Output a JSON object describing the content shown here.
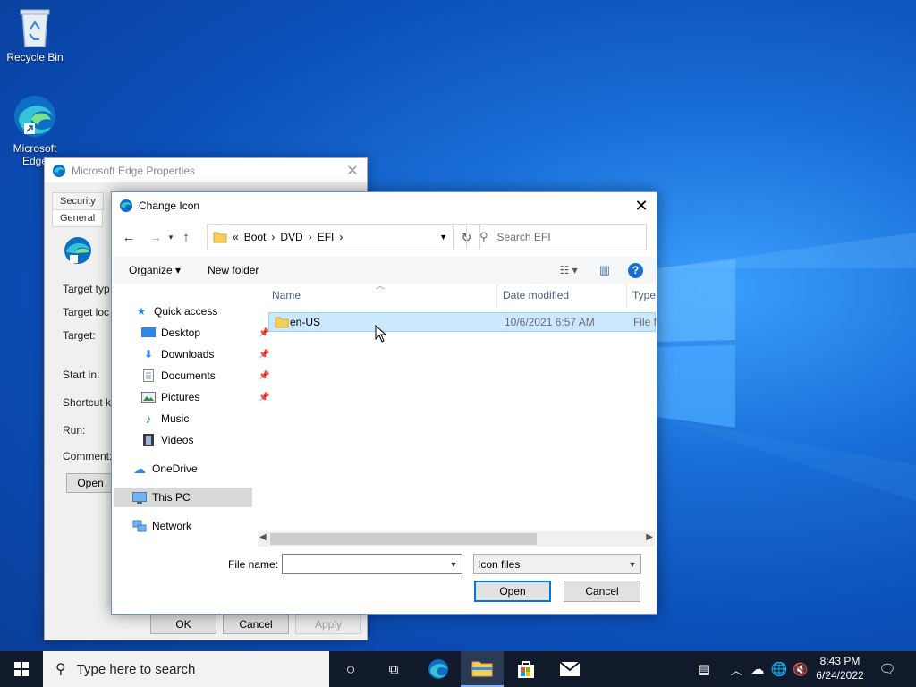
{
  "desktop": {
    "icons": [
      {
        "label": "Recycle Bin"
      },
      {
        "label_line1": "Microsoft",
        "label_line2": "Edge"
      }
    ]
  },
  "properties_window": {
    "title": "Microsoft Edge Properties",
    "tabs": [
      "Security",
      "General"
    ],
    "labels": [
      "Target typ",
      "Target loc",
      "Target:",
      "Start in:",
      "Shortcut k",
      "Run:",
      "Comment:"
    ],
    "open_button": "Open",
    "ok": "OK",
    "cancel": "Cancel",
    "apply": "Apply"
  },
  "dialog": {
    "title": "Change Icon",
    "breadcrumb": [
      "«",
      "Boot",
      "›",
      "DVD",
      "›",
      "EFI",
      "›"
    ],
    "search_placeholder": "Search EFI",
    "organize": "Organize",
    "new_folder": "New folder",
    "sidebar": {
      "quick_access": "Quick access",
      "desktop": "Desktop",
      "downloads": "Downloads",
      "documents": "Documents",
      "pictures": "Pictures",
      "music": "Music",
      "videos": "Videos",
      "onedrive": "OneDrive",
      "this_pc": "This PC",
      "network": "Network"
    },
    "columns": {
      "name": "Name",
      "date": "Date modified",
      "type": "Type"
    },
    "files": [
      {
        "name": "en-US",
        "date": "10/6/2021 6:57 AM",
        "type": "File fo"
      }
    ],
    "file_name_label": "File name:",
    "file_name_value": "",
    "file_type": "Icon files",
    "open": "Open",
    "cancel": "Cancel"
  },
  "taskbar": {
    "search_placeholder": "Type here to search",
    "time": "8:43 PM",
    "date": "6/24/2022"
  }
}
